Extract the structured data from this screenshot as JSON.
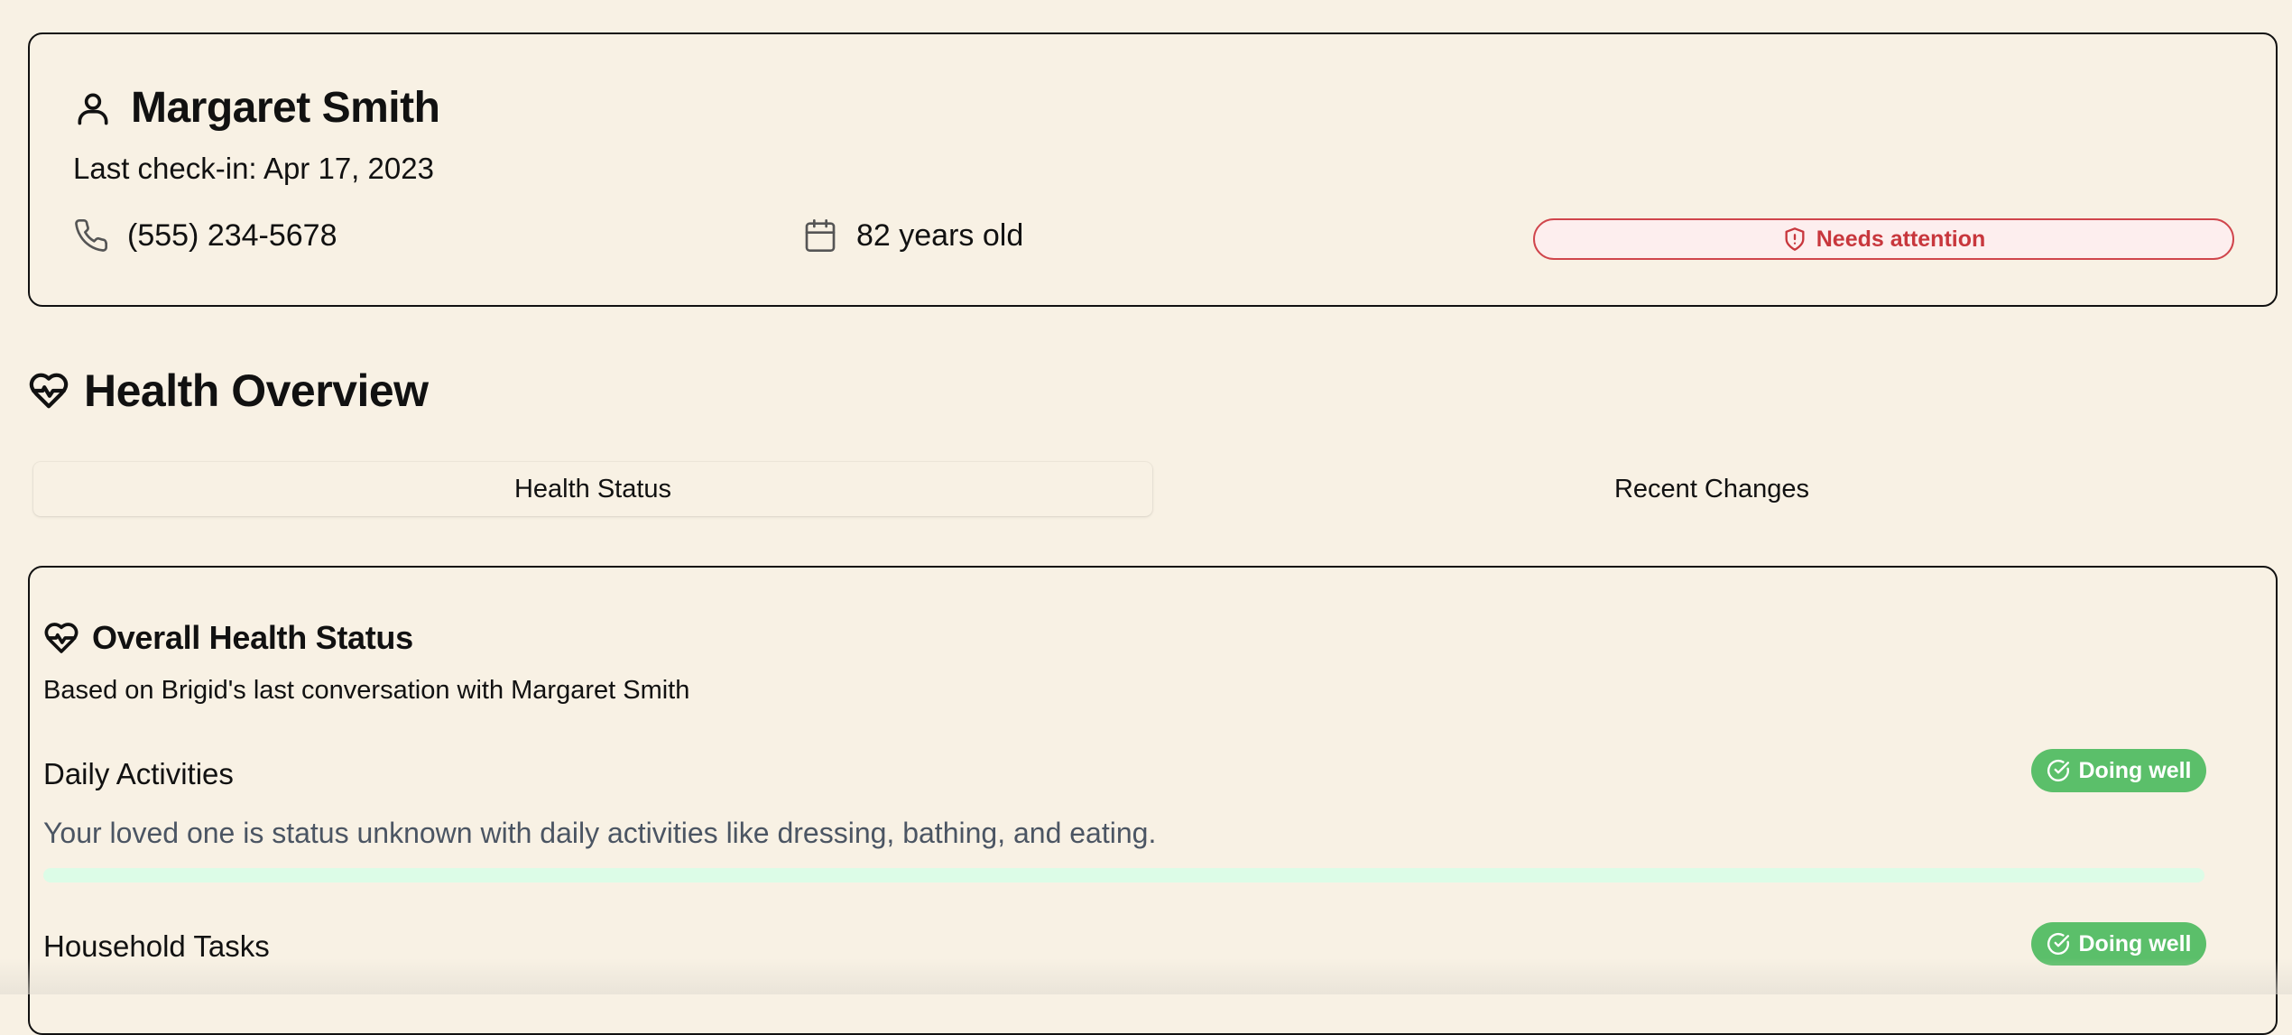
{
  "patient": {
    "name": "Margaret Smith",
    "last_checkin": "Last check-in: Apr 17, 2023",
    "phone": "(555) 234-5678",
    "age": "82 years old",
    "alert_label": "Needs attention",
    "icons": {
      "person": "user-icon",
      "phone": "phone-icon",
      "calendar": "calendar-icon",
      "alert": "shield-alert-icon"
    }
  },
  "section": {
    "title": "Health Overview",
    "icon": "heart-pulse-icon"
  },
  "tabs": [
    {
      "label": "Health Status",
      "active": true
    },
    {
      "label": "Recent Changes",
      "active": false
    }
  ],
  "status_card": {
    "title": "Overall Health Status",
    "icon": "heart-pulse-icon",
    "subtitle": "Based on Brigid's last conversation with Margaret Smith",
    "activities": [
      {
        "title": "Daily Activities",
        "badge": "Doing well",
        "description": "Your loved one is status unknown with daily activities like dressing, bathing, and eating.",
        "progress": 1.0
      },
      {
        "title": "Household Tasks",
        "badge": "Doing well"
      }
    ]
  },
  "colors": {
    "background": "#f8f1e4",
    "alert_red": "#c8373d",
    "alert_bg": "#fdeeee",
    "success_green": "#5bbf6a",
    "progress_track": "#dcfce7",
    "muted_text": "#4b5563"
  }
}
